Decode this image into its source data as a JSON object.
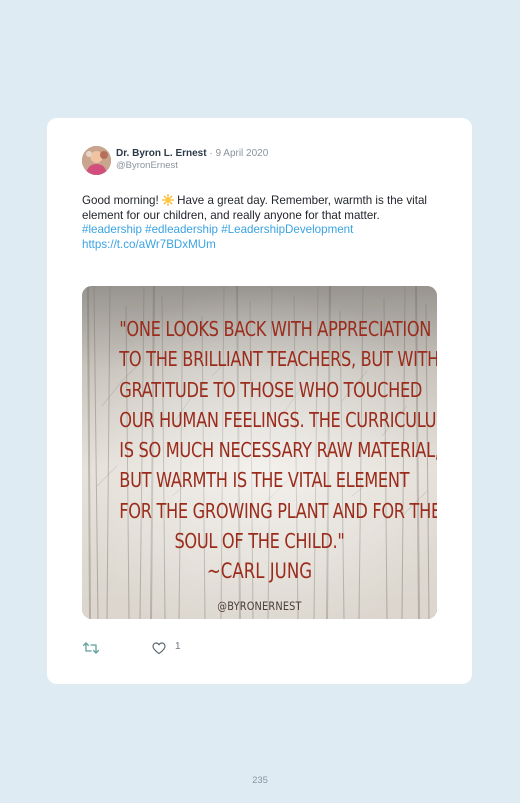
{
  "tweet": {
    "author_name": "Dr. Byron L. Ernest",
    "separator": "·",
    "date": "9 April 2020",
    "handle": "@ByronErnest",
    "text_before_emoji": "Good morning!",
    "emoji": "sun-emoji",
    "text_after_emoji": "Have a great day. Remember, warmth is the vital element for our children, and really anyone for that matter.",
    "hashtags": "#leadership #edleadership #LeadershipDevelopment",
    "link": "https://t.co/aWr7BDxMUm",
    "like_count": "1"
  },
  "media": {
    "quote_lines": [
      "\"ONE LOOKS BACK WITH APPRECIATION",
      "TO THE BRILLIANT TEACHERS, BUT WITH",
      "GRATITUDE TO THOSE WHO TOUCHED",
      "OUR HUMAN FEELINGS. THE CURRICULUM",
      "IS SO MUCH NECESSARY RAW MATERIAL,",
      "BUT WARMTH IS THE VITAL ELEMENT",
      "FOR THE GROWING PLANT AND FOR THE",
      "SOUL OF THE CHILD.\""
    ],
    "quote_author": "~CARL JUNG",
    "watermark": "@BYRONERNEST"
  },
  "page": {
    "number": "235"
  },
  "colors": {
    "page_background": "#deebf3",
    "card_background": "#ffffff",
    "link_blue": "#3aa3e3",
    "quote_red": "#9b2c1c"
  }
}
